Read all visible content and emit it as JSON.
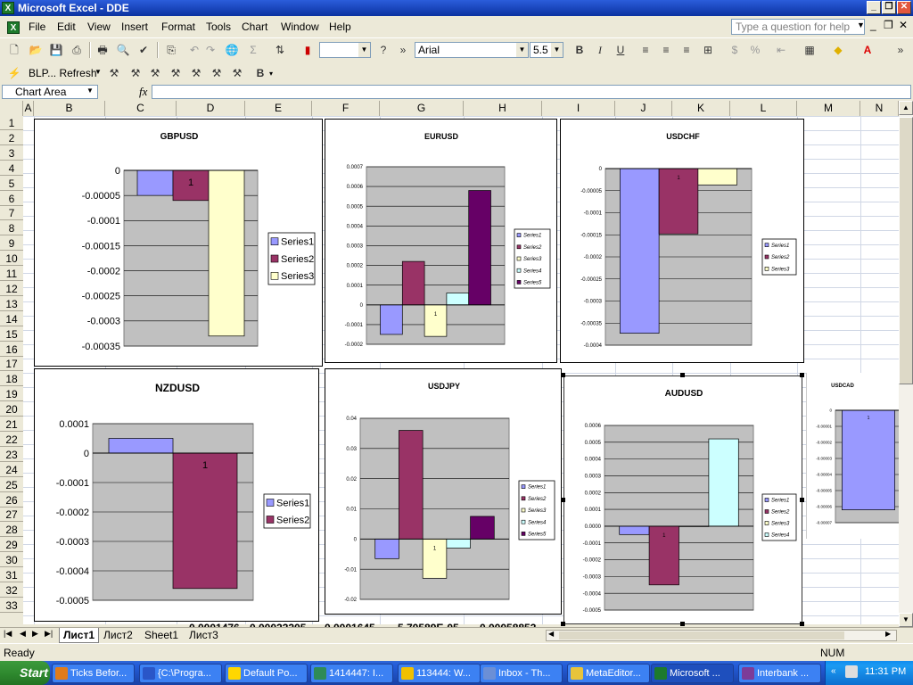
{
  "window": {
    "title": "Microsoft Excel - DDE",
    "app_icon": "X"
  },
  "menu": {
    "file": "File",
    "edit": "Edit",
    "view": "View",
    "insert": "Insert",
    "format": "Format",
    "tools": "Tools",
    "chart": "Chart",
    "window": "Window",
    "help": "Help"
  },
  "help_box": {
    "placeholder": "Type a question for help"
  },
  "toolbar": {
    "font_name": "Arial",
    "font_size": "5.5",
    "bold": "B",
    "italic": "I",
    "underline": "U",
    "blp_refresh": "BLP... Refresh"
  },
  "formula_bar": {
    "name_box": "Chart Area",
    "fx": "fx"
  },
  "columns": [
    "A",
    "B",
    "C",
    "D",
    "E",
    "F",
    "G",
    "H",
    "I",
    "J",
    "K",
    "L",
    "M",
    "N"
  ],
  "rows": [
    "1",
    "2",
    "3",
    "4",
    "5",
    "6",
    "7",
    "8",
    "9",
    "10",
    "11",
    "12",
    "13",
    "14",
    "15",
    "16",
    "17",
    "18",
    "19",
    "20",
    "21",
    "22",
    "23",
    "24",
    "25",
    "26",
    "27",
    "28",
    "29",
    "30",
    "31",
    "32",
    "33"
  ],
  "visible_cells": {
    "d33": "0.0001476",
    "e33": "0.00023205",
    "f33": "0.0001645",
    "g33": "5.70589E-05",
    "h33": "0.00058853"
  },
  "sheet_tabs": [
    "Лист1",
    "Лист2",
    "Sheet1",
    "Лист3"
  ],
  "status": {
    "ready": "Ready",
    "num": "NUM"
  },
  "taskbar": {
    "start": "Start",
    "items": [
      "Ticks Befor...",
      "{C:\\Progra...",
      "Default Po...",
      "1414447: I...",
      "113444: W...",
      "Inbox - Th...",
      "MetaEditor...",
      "Microsoft ...",
      "Interbank ..."
    ],
    "clock": "11:31 PM"
  },
  "colors": {
    "s1": "#9999ff",
    "s2": "#993366",
    "s3": "#ffffcc",
    "s4": "#ccffff",
    "s5": "#660066",
    "plot": "#c0c0c0"
  },
  "chart_data": [
    {
      "type": "bar",
      "title": "GBPUSD",
      "series": [
        {
          "name": "Series1",
          "values": [
            -5e-05
          ]
        },
        {
          "name": "Series2",
          "values": [
            -6e-05
          ]
        },
        {
          "name": "Series3",
          "values": [
            -0.00033
          ]
        }
      ],
      "categories": [
        "1"
      ],
      "ylim": [
        -0.00035,
        0
      ],
      "ticks": [
        "0",
        "-0.00005",
        "-0.0001",
        "-0.00015",
        "-0.0002",
        "-0.00025",
        "-0.0003",
        "-0.00035"
      ],
      "legend": "right"
    },
    {
      "type": "bar",
      "title": "EURUSD",
      "series": [
        {
          "name": "Series1",
          "values": [
            -0.00015
          ]
        },
        {
          "name": "Series2",
          "values": [
            0.00022
          ]
        },
        {
          "name": "Series3",
          "values": [
            -0.00016
          ]
        },
        {
          "name": "Series4",
          "values": [
            6e-05
          ]
        },
        {
          "name": "Series5",
          "values": [
            0.00058
          ]
        }
      ],
      "categories": [
        "1"
      ],
      "ylim": [
        -0.0002,
        0.0007
      ],
      "ticks": [
        "0.0007",
        "0.0006",
        "0.0005",
        "0.0004",
        "0.0003",
        "0.0002",
        "0.0001",
        "0",
        "-0.0001",
        "-0.0002"
      ],
      "legend": "right"
    },
    {
      "type": "bar",
      "title": "USDCHF",
      "series": [
        {
          "name": "Series1",
          "values": [
            -0.000373
          ]
        },
        {
          "name": "Series2",
          "values": [
            -0.000148
          ]
        },
        {
          "name": "Series3",
          "values": [
            -3.7e-05
          ]
        }
      ],
      "categories": [
        "1"
      ],
      "ylim": [
        -0.0004,
        0
      ],
      "ticks": [
        "0",
        "-0.00005",
        "-0.0001",
        "-0.00015",
        "-0.0002",
        "-0.00025",
        "-0.0003",
        "-0.00035",
        "-0.0004"
      ],
      "legend": "right"
    },
    {
      "type": "bar",
      "title": "NZDUSD",
      "series": [
        {
          "name": "Series1",
          "values": [
            5e-05
          ]
        },
        {
          "name": "Series2",
          "values": [
            -0.00046
          ]
        }
      ],
      "categories": [
        "1"
      ],
      "ylim": [
        -0.0005,
        0.0001
      ],
      "ticks": [
        "0.0001",
        "0",
        "-0.0001",
        "-0.0002",
        "-0.0003",
        "-0.0004",
        "-0.0005"
      ],
      "legend": "right"
    },
    {
      "type": "bar",
      "title": "USDJPY",
      "series": [
        {
          "name": "Series1",
          "values": [
            -0.0065
          ]
        },
        {
          "name": "Series2",
          "values": [
            0.036
          ]
        },
        {
          "name": "Series3",
          "values": [
            -0.013
          ]
        },
        {
          "name": "Series4",
          "values": [
            -0.003
          ]
        },
        {
          "name": "Series5",
          "values": [
            0.0075
          ]
        }
      ],
      "categories": [
        "1"
      ],
      "ylim": [
        -0.02,
        0.04
      ],
      "ticks": [
        "0.04",
        "0.03",
        "0.02",
        "0.01",
        "0",
        "-0.01",
        "-0.02"
      ],
      "legend": "right"
    },
    {
      "type": "bar",
      "title": "AUDUSD",
      "series": [
        {
          "name": "Series1",
          "values": [
            -5e-05
          ]
        },
        {
          "name": "Series2",
          "values": [
            -0.00035
          ]
        },
        {
          "name": "Series3",
          "values": [
            0
          ]
        },
        {
          "name": "Series4",
          "values": [
            0.00052
          ]
        }
      ],
      "categories": [
        "1"
      ],
      "ylim": [
        -0.0005,
        0.0006
      ],
      "ticks": [
        "0.0006",
        "0.0005",
        "0.0004",
        "0.0003",
        "0.0002",
        "0.0001",
        "0.0000",
        "-0.0001",
        "-0.0002",
        "-0.0003",
        "-0.0004",
        "-0.0005"
      ],
      "legend": "right"
    },
    {
      "type": "bar",
      "title": "USDCAD",
      "series": [
        {
          "name": "",
          "values": [
            -6.2e-05
          ]
        }
      ],
      "categories": [
        "1"
      ],
      "ylim": [
        -7e-05,
        0
      ],
      "ticks": [
        "0",
        "-0.00001",
        "-0.00002",
        "-0.00003",
        "-0.00004",
        "-0.00005",
        "-0.00006",
        "-0.00007"
      ],
      "legend": "none"
    }
  ]
}
